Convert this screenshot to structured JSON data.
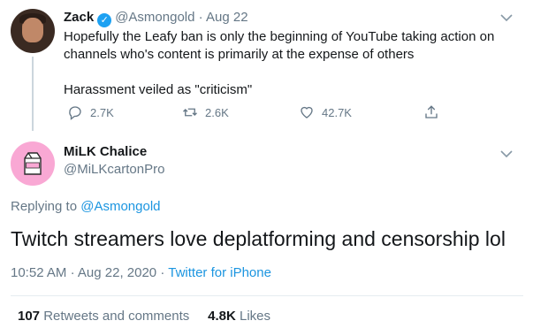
{
  "parent_tweet": {
    "display_name": "Zack",
    "handle": "@Asmongold",
    "separator": "·",
    "date": "Aug 22",
    "text_line1": "Hopefully the Leafy ban is only the beginning of YouTube taking action on channels who's content is primarily at the expense of others",
    "text_line2": "Harassment veiled as \"criticism\"",
    "replies": "2.7K",
    "retweets": "2.6K",
    "likes": "42.7K",
    "verified": true
  },
  "reply_tweet": {
    "display_name": "MiLK Chalice",
    "handle": "@MiLKcartonPro",
    "replying_prefix": "Replying to",
    "replying_to": "@Asmongold",
    "text": "Twitch streamers love deplatforming and censorship lol",
    "time": "10:52 AM",
    "separator1": "·",
    "date": "Aug 22, 2020",
    "separator2": "·",
    "source": "Twitter for iPhone",
    "retweets_count": "107",
    "retweets_label": "Retweets and comments",
    "likes_count": "4.8K",
    "likes_label": "Likes"
  },
  "icons": {
    "reply": "reply-icon",
    "retweet": "retweet-icon",
    "like": "heart-icon",
    "share": "share-icon",
    "more": "chevron-down-icon"
  },
  "colors": {
    "verified": "#1da1f2",
    "link": "#1b95e0",
    "muted": "#657786",
    "text": "#14171a"
  }
}
